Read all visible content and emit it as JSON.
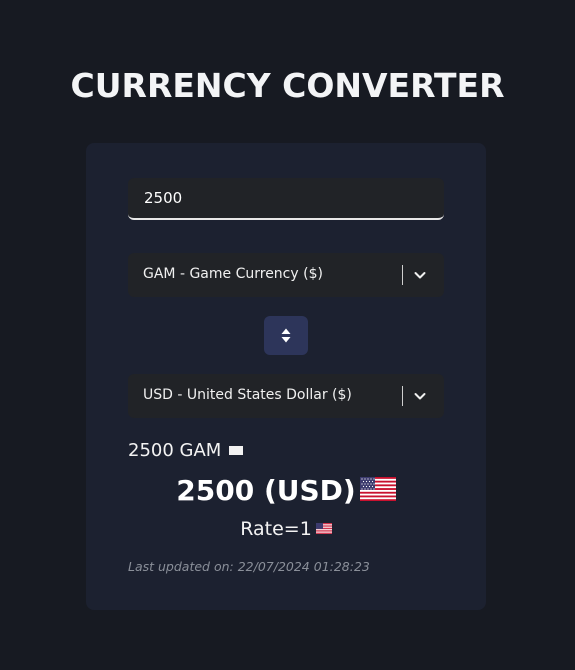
{
  "header": {
    "title": "CURRENCY CONVERTER"
  },
  "converter": {
    "amount": "2500",
    "from_select": {
      "label": "GAM - Game Currency ($)",
      "icon": "chevron-down-icon"
    },
    "swap_icon": "swap-vertical-icon",
    "to_select": {
      "label": "USD - United States Dollar ($)",
      "icon": "chevron-down-icon"
    }
  },
  "result": {
    "source_text": "2500 GAM",
    "source_flag": "blank-flag-icon",
    "converted_text": "2500 (USD)",
    "converted_flag": "us-flag-icon",
    "rate_text": "Rate=1",
    "rate_flag": "us-flag-icon",
    "last_updated": "Last updated on: 22/07/2024 01:28:23"
  },
  "colors": {
    "background": "#171a22",
    "card": "#1c2130",
    "field": "#212327",
    "swap_button": "#2d355a",
    "muted_text": "#8a8f99"
  }
}
